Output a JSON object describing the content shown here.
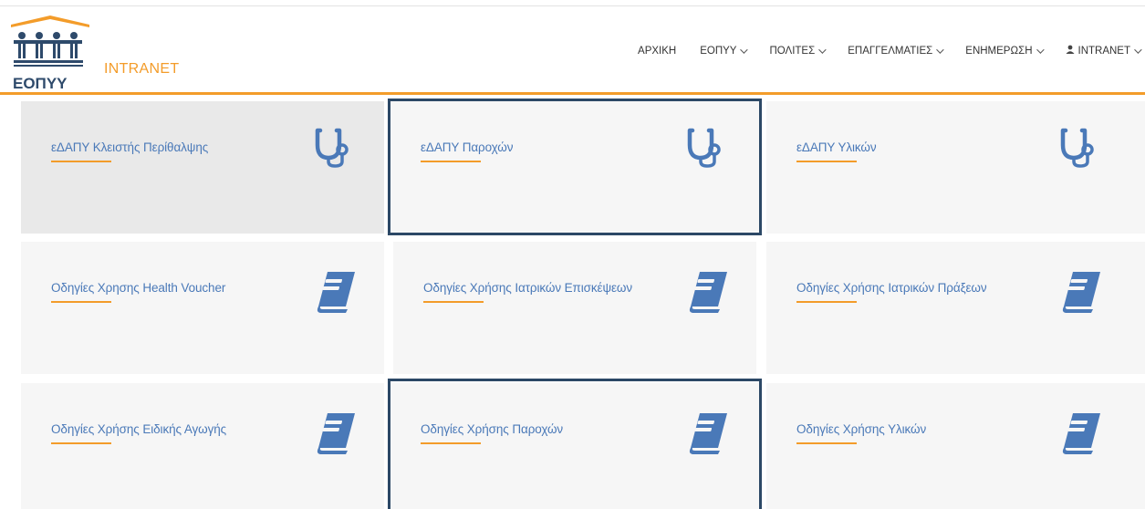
{
  "header": {
    "logo_text": "ΕΟΠΥΥ",
    "brand": "INTRANET"
  },
  "nav": {
    "items": [
      {
        "label": "ΑΡΧΙΚΗ",
        "dropdown": false
      },
      {
        "label": "ΕΟΠΥΥ",
        "dropdown": true
      },
      {
        "label": "ΠΟΛΙΤΕΣ",
        "dropdown": true
      },
      {
        "label": "ΕΠΑΓΓΕΛΜΑΤΙΕΣ",
        "dropdown": true
      },
      {
        "label": "ΕΝΗΜΕΡΩΣΗ",
        "dropdown": true
      },
      {
        "label": "INTRANET",
        "dropdown": true,
        "icon": "user-icon"
      }
    ]
  },
  "tiles": [
    {
      "label": "εΔΑΠΥ Κλειστής Περίθαλψης",
      "icon": "stethoscope-icon"
    },
    {
      "label": "εΔΑΠΥ Παροχών",
      "icon": "stethoscope-icon"
    },
    {
      "label": "εΔΑΠΥ Υλικών",
      "icon": "stethoscope-icon"
    },
    {
      "label": "Οδηγίες Χρησης Health Voucher",
      "icon": "book-icon"
    },
    {
      "label": "Οδηγίες Χρήσης Ιατρικών Επισκέψεων",
      "icon": "book-icon"
    },
    {
      "label": "Οδηγίες Χρήσης Ιατρικών Πράξεων",
      "icon": "book-icon"
    },
    {
      "label": "Οδηγίες Χρήσης Ειδικής Αγωγής",
      "icon": "book-icon"
    },
    {
      "label": "Οδηγίες Χρήσης Παροχών",
      "icon": "book-icon"
    },
    {
      "label": "Οδηγίες Χρήσης Υλικών",
      "icon": "book-icon"
    }
  ],
  "colors": {
    "accent": "#f39c2a",
    "link": "#4a79b8",
    "icon": "#4a79b8",
    "highlight": "#2c4866"
  }
}
